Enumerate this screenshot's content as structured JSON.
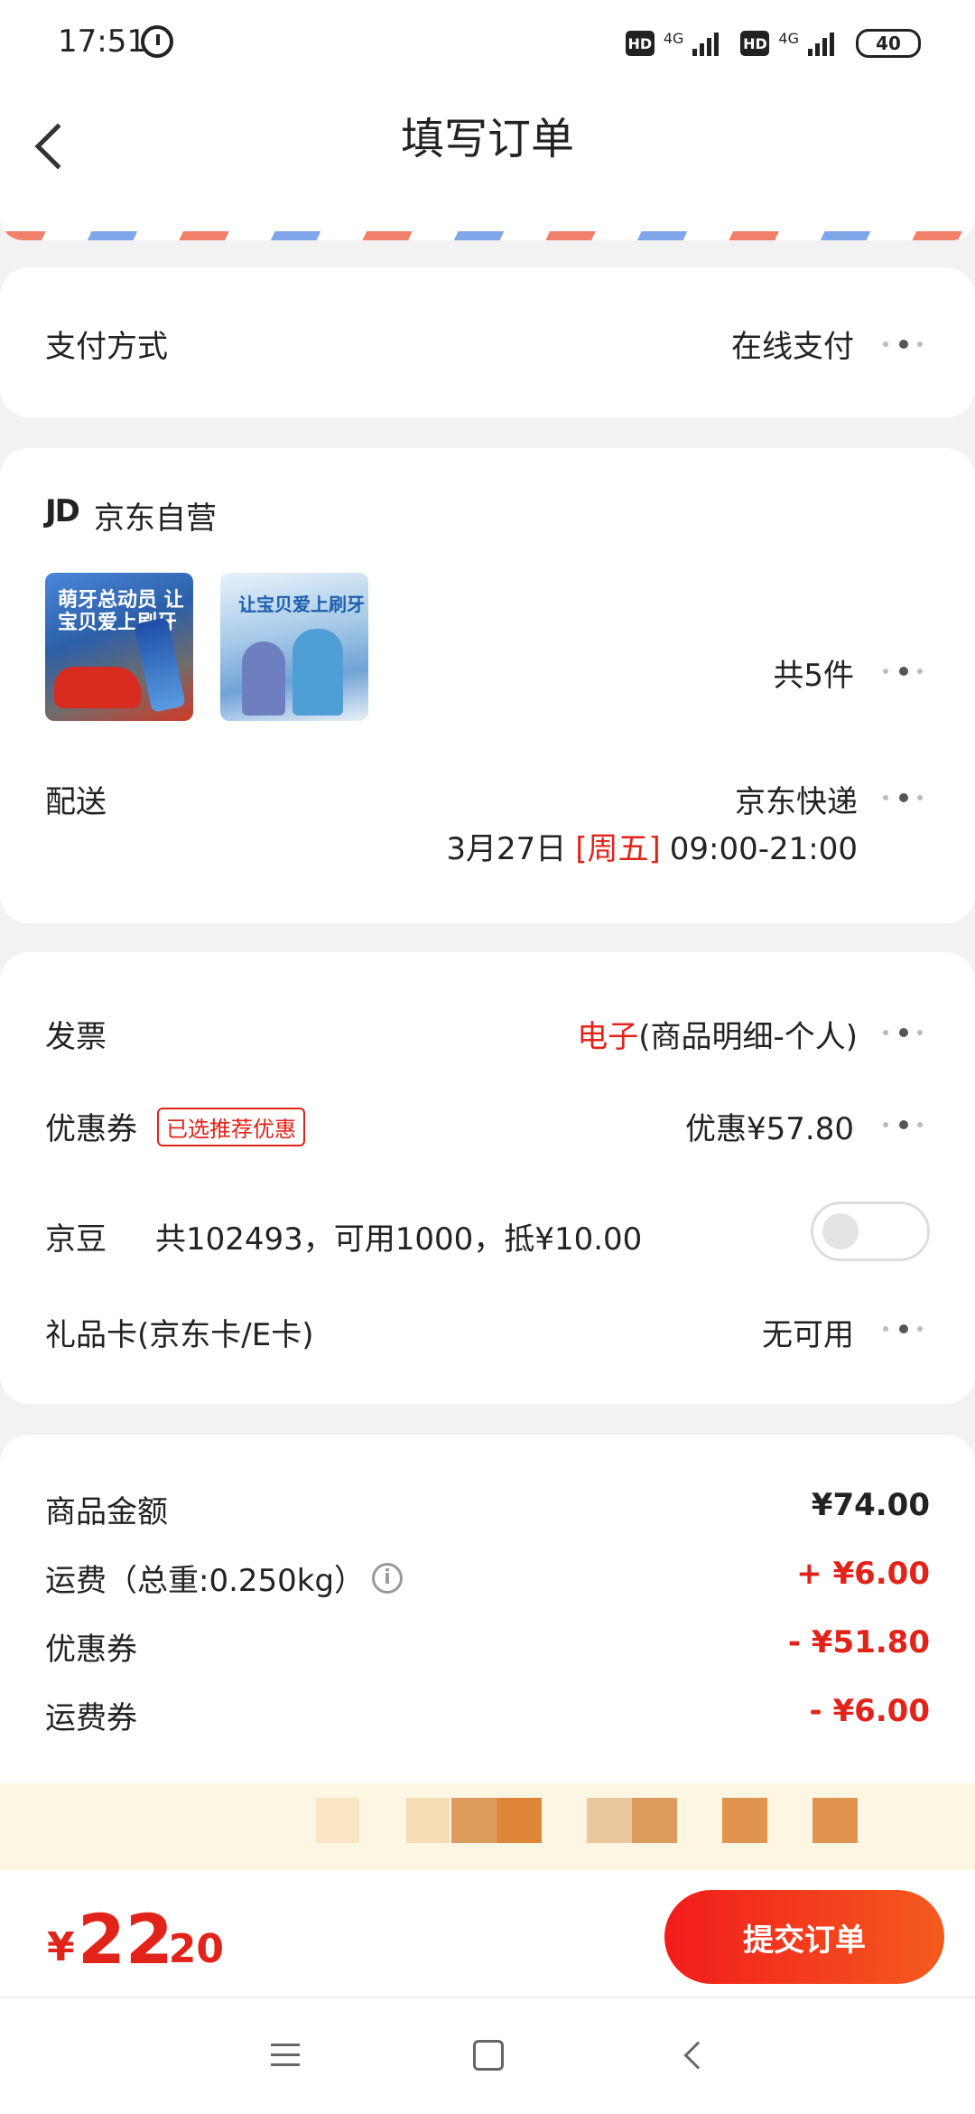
{
  "status_bar": {
    "time": "17:51",
    "hd1": "HD",
    "net1": "4G",
    "hd2": "HD",
    "net2": "4G",
    "battery": "40"
  },
  "header": {
    "title": "填写订单"
  },
  "payment": {
    "label": "支付方式",
    "value": "在线支付"
  },
  "shop": {
    "logo": "JD",
    "name": "京东自营",
    "thumb1_text": "萌牙总动员 让宝贝爱上刷牙",
    "thumb2_text": "让宝贝爱上刷牙",
    "count": "共5件",
    "delivery_label": "配送",
    "delivery_value": "京东快递",
    "delivery_date": "3月27日",
    "delivery_weekday": "[周五]",
    "delivery_time": "09:00-21:00"
  },
  "benefits": {
    "invoice_label": "发票",
    "invoice_type": "电子",
    "invoice_detail": "(商品明细-个人)",
    "coupon_label": "优惠券",
    "coupon_tag": "已选推荐优惠",
    "coupon_value": "优惠¥57.80",
    "jingdou_label": "京豆",
    "jingdou_info": "共102493，可用1000，抵¥10.00",
    "giftcard_label": "礼品卡(京东卡/E卡)",
    "giftcard_value": "无可用"
  },
  "summary": {
    "goods_label": "商品金额",
    "goods_value": "¥74.00",
    "freight_label": "运费（总重:0.250kg）",
    "freight_value": "+ ¥6.00",
    "coupon_label": "优惠券",
    "coupon_value": "- ¥51.80",
    "freight_coupon_label": "运费券",
    "freight_coupon_value": "- ¥6.00"
  },
  "bottom_bar": {
    "currency": "¥",
    "price_int": "22",
    "price_dec": ".20",
    "submit_label": "提交订单"
  },
  "colors": {
    "accent_red": "#e2231a",
    "button_gradient_start": "#f21c1c",
    "button_gradient_end": "#f45b1e"
  }
}
